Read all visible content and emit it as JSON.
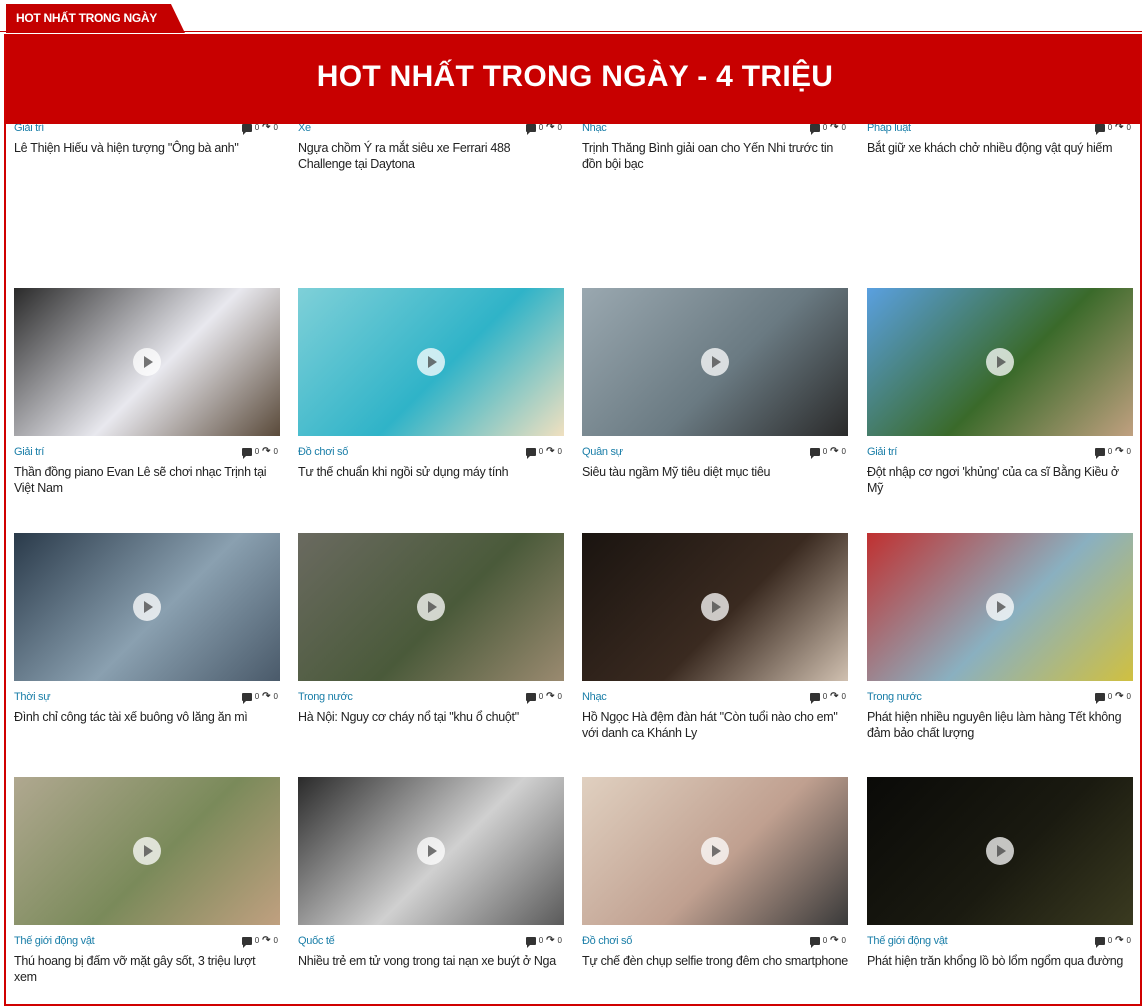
{
  "section_tab": {
    "label": "HOT NHẤT TRONG NGÀY"
  },
  "banner": {
    "title": "HOT NHẤT TRONG NGÀY - 4 TRIỆU"
  },
  "articles": [
    {
      "category": "Giải trí",
      "title": "Lê Thiện Hiếu và hiện tượng \"Ông bà anh\"",
      "comments": "0",
      "shares": "0",
      "thumb": [
        "#1a1a1a",
        "#3a3030",
        "#8a6a5a"
      ]
    },
    {
      "category": "Xe",
      "title": "Ngựa chồm Ý ra mắt siêu xe Ferrari 488 Challenge tại Daytona",
      "comments": "0",
      "shares": "0",
      "thumb": [
        "#2a2a2a",
        "#e8c21a",
        "#444"
      ]
    },
    {
      "category": "Nhạc",
      "title": "Trịnh Thăng Bình giải oan cho Yến Nhi trước tin đồn bội bạc",
      "comments": "0",
      "shares": "0",
      "thumb": [
        "#b98a3a",
        "#c03030",
        "#d9b070"
      ]
    },
    {
      "category": "Pháp luật",
      "title": "Bắt giữ xe khách chở nhiều động vật quý hiếm",
      "comments": "0",
      "shares": "0",
      "thumb": [
        "#6a6a5a",
        "#3a3a32",
        "#8a8a7a"
      ]
    },
    {
      "category": "Giải trí",
      "title": "Thần đồng piano Evan Lê sẽ chơi nhạc Trịnh tại Việt Nam",
      "comments": "0",
      "shares": "0",
      "thumb": [
        "#2a2a2a",
        "#e8e8ee",
        "#5a4a3a"
      ]
    },
    {
      "category": "Đồ chơi số",
      "title": "Tư thế chuẩn khi ngồi sử dụng máy tính",
      "comments": "0",
      "shares": "0",
      "thumb": [
        "#7fd0d8",
        "#2fb3c8",
        "#f0e0c0"
      ]
    },
    {
      "category": "Quân sự",
      "title": "Siêu tàu ngầm Mỹ tiêu diệt mục tiêu",
      "comments": "0",
      "shares": "0",
      "thumb": [
        "#9aa8b0",
        "#6a7a82",
        "#2a2a2a"
      ]
    },
    {
      "category": "Giải trí",
      "title": "Đột nhập cơ ngơi 'khủng' của ca sĩ Bằng Kiều ở Mỹ",
      "comments": "0",
      "shares": "0",
      "thumb": [
        "#5aa0e0",
        "#3a6a2a",
        "#c0a080"
      ]
    },
    {
      "category": "Thời sự",
      "title": "Đình chỉ công tác tài xế buông vô lăng ăn mì",
      "comments": "0",
      "shares": "0",
      "thumb": [
        "#2a3a4a",
        "#8aa0b0",
        "#4a5a6a"
      ]
    },
    {
      "category": "Trong nước",
      "title": "Hà Nội: Nguy cơ cháy nổ tại \"khu ổ chuột\"",
      "comments": "0",
      "shares": "0",
      "thumb": [
        "#6a6a60",
        "#4a5a3a",
        "#9a8a70"
      ]
    },
    {
      "category": "Nhạc",
      "title": "Hồ Ngọc Hà đệm đàn hát \"Còn tuổi nào cho em\" với danh ca Khánh Ly",
      "comments": "0",
      "shares": "0",
      "thumb": [
        "#1a1410",
        "#3a2a20",
        "#d0c0b0"
      ]
    },
    {
      "category": "Trong nước",
      "title": "Phát hiện nhiều nguyên liệu làm hàng Tết không đảm bảo chất lượng",
      "comments": "0",
      "shares": "0",
      "thumb": [
        "#c03030",
        "#8ab0c0",
        "#d0c040"
      ]
    },
    {
      "category": "Thế giới động vật",
      "title": "Thú hoang bị đấm vỡ mặt gây sốt, 3 triệu lượt xem",
      "comments": "0",
      "shares": "0",
      "thumb": [
        "#b0a890",
        "#7a8a5a",
        "#c0a080"
      ]
    },
    {
      "category": "Quốc tế",
      "title": "Nhiều trẻ em tử vong trong tai nạn xe buýt ở Nga",
      "comments": "0",
      "shares": "0",
      "thumb": [
        "#2a2a2a",
        "#d0d0d0",
        "#5a5a5a"
      ]
    },
    {
      "category": "Đồ chơi số",
      "title": "Tự chế đèn chụp selfie trong đêm cho smartphone",
      "comments": "0",
      "shares": "0",
      "thumb": [
        "#e0d0c0",
        "#c0a090",
        "#3a3a3a"
      ]
    },
    {
      "category": "Thế giới động vật",
      "title": "Phát hiện trăn khổng lồ bò lổm ngổm qua đường",
      "comments": "0",
      "shares": "0",
      "thumb": [
        "#0a0a08",
        "#1a1a10",
        "#3a3a20"
      ]
    }
  ],
  "colors": {
    "accent": "#c80000",
    "category": "#1a7ea8"
  }
}
